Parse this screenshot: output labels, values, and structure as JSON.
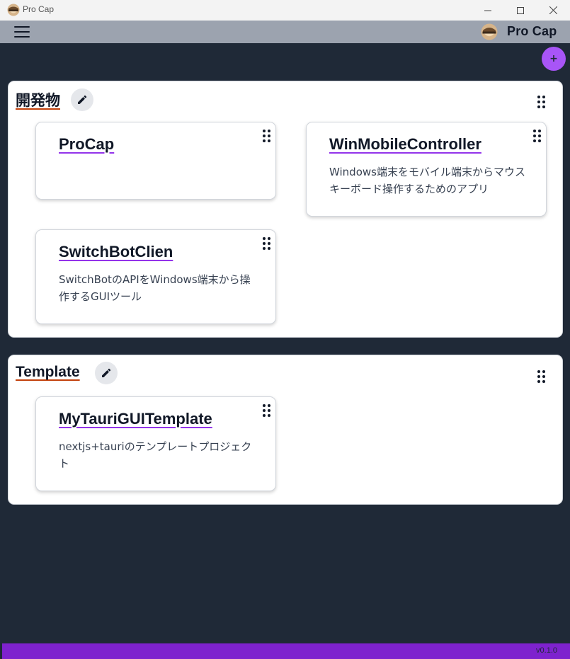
{
  "window": {
    "title": "Pro Cap",
    "minimize_icon": "minimize-icon",
    "maximize_icon": "maximize-icon",
    "close_icon": "close-icon"
  },
  "header": {
    "menu_icon": "hamburger-menu-icon",
    "brand": "Pro Cap",
    "logo_icon": "app-logo-icon"
  },
  "actions": {
    "add_label": "+"
  },
  "groups": [
    {
      "title": "開発物",
      "edit_icon": "pencil-icon",
      "drag_icon": "drag-handle-icon",
      "cards": [
        {
          "title": "ProCap",
          "description": ""
        },
        {
          "title": "WinMobileController",
          "description": "Windows端末をモバイル端末からマウスキーボード操作するためのアプリ"
        },
        {
          "title": "SwitchBotClien",
          "description": "SwitchBotのAPIをWindows端末から操作するGUIツール"
        }
      ]
    },
    {
      "title": "Template",
      "edit_icon": "pencil-icon",
      "drag_icon": "drag-handle-icon",
      "cards": [
        {
          "title": "MyTauriGUITemplate",
          "description": "nextjs+tauriのテンプレートプロジェクト"
        }
      ]
    }
  ],
  "footer": {
    "version": "v0.1.0"
  },
  "colors": {
    "header_bg": "#9ca3af",
    "main_bg": "#1f2937",
    "fab_bg": "#a855f7",
    "footer_bg": "#7e22ce",
    "group_title_underline": "#c2410c",
    "card_title_underline": "#9333ea"
  }
}
